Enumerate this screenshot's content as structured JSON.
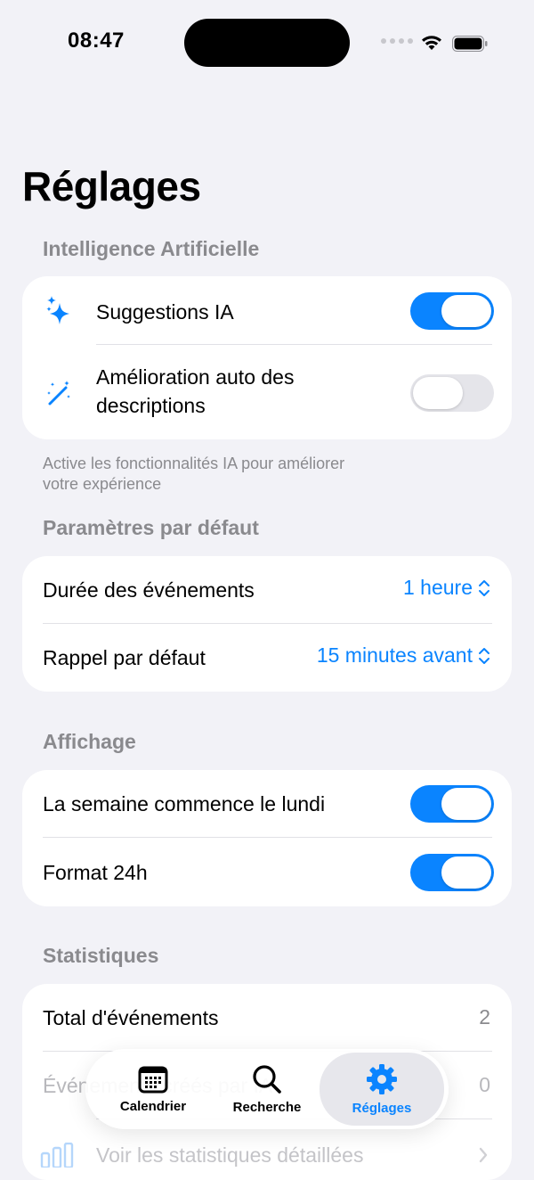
{
  "status": {
    "time": "08:47"
  },
  "page_title": "Réglages",
  "sections": {
    "ai": {
      "header": "Intelligence Artificielle",
      "rows": [
        {
          "label": "Suggestions IA",
          "toggle": true
        },
        {
          "label_line1": "Amélioration auto des",
          "label_line2": "descriptions",
          "toggle": false
        }
      ],
      "footnote_line1": "Active les fonctionnalités IA pour améliorer",
      "footnote_line2": "votre expérience"
    },
    "defaults": {
      "header": "Paramètres par défaut",
      "rows": [
        {
          "label": "Durée des événements",
          "value": "1 heure"
        },
        {
          "label": "Rappel par défaut",
          "value": "15 minutes avant"
        }
      ]
    },
    "display": {
      "header": "Affichage",
      "rows": [
        {
          "label": "La semaine commence le lundi",
          "toggle": true
        },
        {
          "label": "Format 24h",
          "toggle": true
        }
      ]
    },
    "stats": {
      "header": "Statistiques",
      "rows": [
        {
          "label": "Total d'événements",
          "value": "2"
        },
        {
          "label": "Événements créés par IA",
          "value": "0"
        },
        {
          "label": "Voir les statistiques détaillées"
        }
      ]
    }
  },
  "tabbar": {
    "tabs": [
      {
        "label": "Calendrier",
        "icon": "calendar-icon"
      },
      {
        "label": "Recherche",
        "icon": "magnifier-icon"
      },
      {
        "label": "Réglages",
        "icon": "gear-icon",
        "active": true
      }
    ]
  },
  "colors": {
    "accent": "#0a84ff",
    "background": "#f2f2f7",
    "secondary_text": "#8a8a8e"
  }
}
